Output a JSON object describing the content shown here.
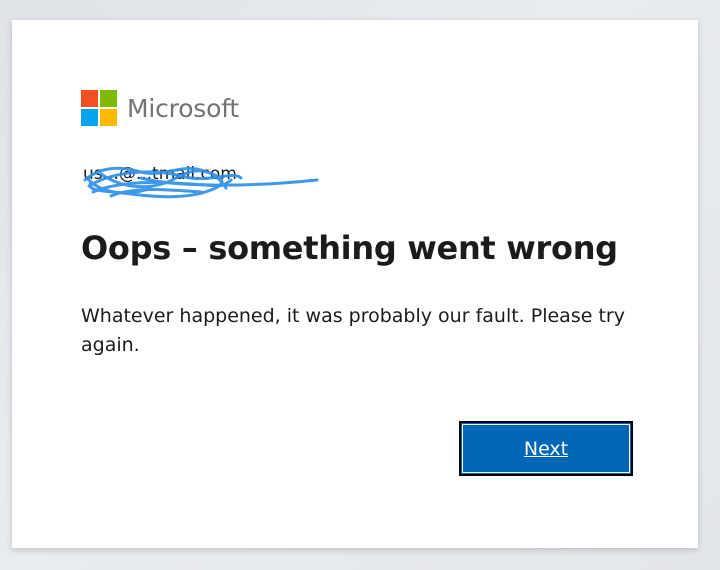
{
  "brand": {
    "name": "Microsoft",
    "logo_colors": [
      "#f25022",
      "#7fba00",
      "#00a4ef",
      "#ffb900"
    ]
  },
  "identity": {
    "email_visible": "us...@...tmail.com",
    "redaction_color": "#2a8ee8"
  },
  "error": {
    "title": "Oops – something went wrong",
    "message": "Whatever happened, it was probably our fault. Please try again."
  },
  "actions": {
    "next_label": "Next",
    "accent": "#0067b8"
  }
}
